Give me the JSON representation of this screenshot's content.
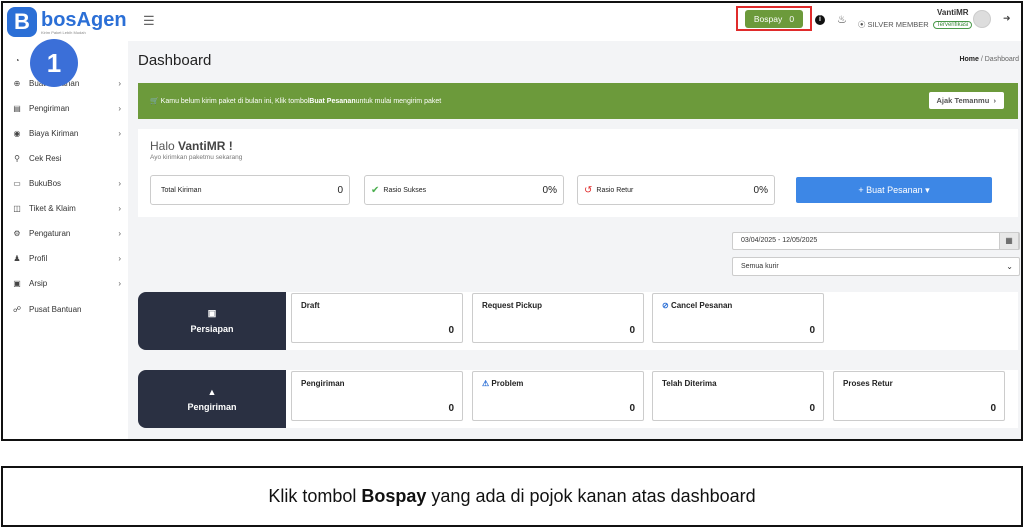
{
  "app": {
    "logo_mark": "B",
    "logo_name": "bosAgen",
    "logo_tagline": "Kirim Paket Lebih Mudah"
  },
  "header": {
    "bospay_label": "Bospay",
    "bospay_amount": "0",
    "user_name": "VantiMR",
    "membership": "SILVER MEMBER",
    "verified_label": "Terverifikasi"
  },
  "step_number": "1",
  "sidebar": {
    "items": [
      {
        "label": "",
        "icon": "gauge-icon",
        "chevron": false
      },
      {
        "label": "Buat Pesanan",
        "icon": "plus-circle-icon",
        "chevron": true
      },
      {
        "label": "Pengiriman",
        "icon": "document-icon",
        "chevron": true
      },
      {
        "label": "Biaya Kiriman",
        "icon": "location-icon",
        "chevron": true
      },
      {
        "label": "Cek Resi",
        "icon": "search-icon",
        "chevron": false
      },
      {
        "label": "BukuBos",
        "icon": "card-icon",
        "chevron": true
      },
      {
        "label": "Tiket & Klaim",
        "icon": "ticket-icon",
        "chevron": true
      },
      {
        "label": "Pengaturan",
        "icon": "gear-icon",
        "chevron": true
      },
      {
        "label": "Profil",
        "icon": "user-icon",
        "chevron": true
      },
      {
        "label": "Arsip",
        "icon": "archive-icon",
        "chevron": true
      },
      {
        "label": "Pusat Bantuan",
        "icon": "headset-icon",
        "chevron": false
      }
    ]
  },
  "main": {
    "title": "Dashboard",
    "breadcrumb_home": "Home",
    "breadcrumb_sep": "/",
    "breadcrumb_current": "Dashboard",
    "alert_pre": "Kamu belum kirim paket di bulan ini, Klik tombol ",
    "alert_bold": "Buat Pesanan",
    "alert_post": " untuk mulai mengirim paket",
    "alert_button": "Ajak Temanmu",
    "greeting_pre": "Halo ",
    "greeting_name": "VantiMR !",
    "greeting_sub": "Ayo kirimkan paketmu sekarang",
    "stats": [
      {
        "label": "Total Kiriman",
        "value": "0"
      },
      {
        "label": "Rasio Sukses",
        "value": "0%"
      },
      {
        "label": "Rasio Retur",
        "value": "0%"
      }
    ],
    "create_button": "+ Buat Pesanan",
    "date_range": "03/04/2025 - 12/05/2025",
    "courier_select": "Semua kurir"
  },
  "groups": [
    {
      "label": "Persiapan",
      "icon": "box-icon",
      "items": [
        {
          "label": "Draft",
          "value": "0"
        },
        {
          "label": "Request Pickup",
          "value": "0"
        },
        {
          "label": "Cancel Pesanan",
          "value": "0"
        }
      ]
    },
    {
      "label": "Pengiriman",
      "icon": "car-icon",
      "items": [
        {
          "label": "Pengiriman",
          "value": "0"
        },
        {
          "label": "Problem",
          "value": "0"
        },
        {
          "label": "Telah Diterima",
          "value": "0"
        },
        {
          "label": "Proses Retur",
          "value": "0"
        }
      ]
    }
  ],
  "caption": {
    "pre": "Klik tombol ",
    "bold": "Bospay",
    "post": " yang ada di pojok kanan atas dashboard"
  },
  "colors": {
    "brand_blue": "#2b6fd6",
    "accent_green": "#6c9a3b",
    "dark_navy": "#2a3042",
    "highlight_red": "#e02b2b",
    "button_blue": "#3d87e6"
  }
}
